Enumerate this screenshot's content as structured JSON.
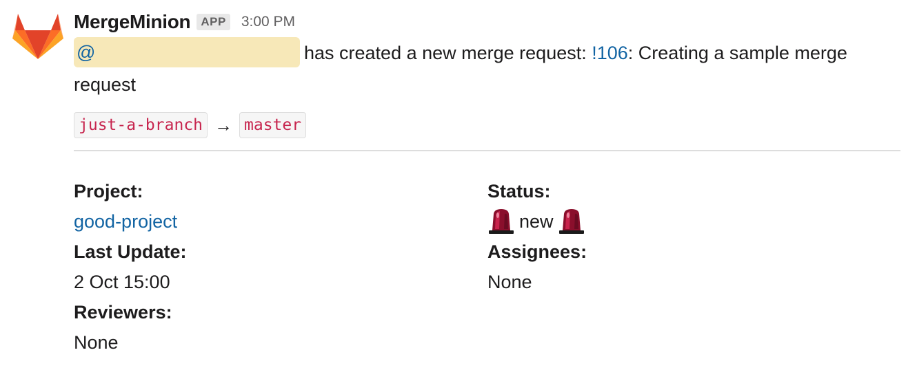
{
  "message": {
    "sender": "MergeMinion",
    "badge": "APP",
    "time": "3:00 PM",
    "mention": "@",
    "text_before_link": "has created a new merge request: ",
    "mr_link": "!106",
    "text_after_link": ": Creating a sample merge request",
    "source_branch": "just-a-branch",
    "arrow": "→",
    "target_branch": "master",
    "avatar_icon": "gitlab-fox-icon",
    "status_icon": "rotating-light-icon"
  },
  "fields": {
    "project_label": "Project:",
    "project_value": "good-project",
    "last_update_label": "Last Update:",
    "last_update_value": "2 Oct 15:00",
    "reviewers_label": "Reviewers:",
    "reviewers_value": "None",
    "status_label": "Status:",
    "status_value": "new",
    "assignees_label": "Assignees:",
    "assignees_value": "None"
  },
  "colors": {
    "link": "#1264a3",
    "mention_bg": "#f7e8b8",
    "code_text": "#c7254e"
  }
}
